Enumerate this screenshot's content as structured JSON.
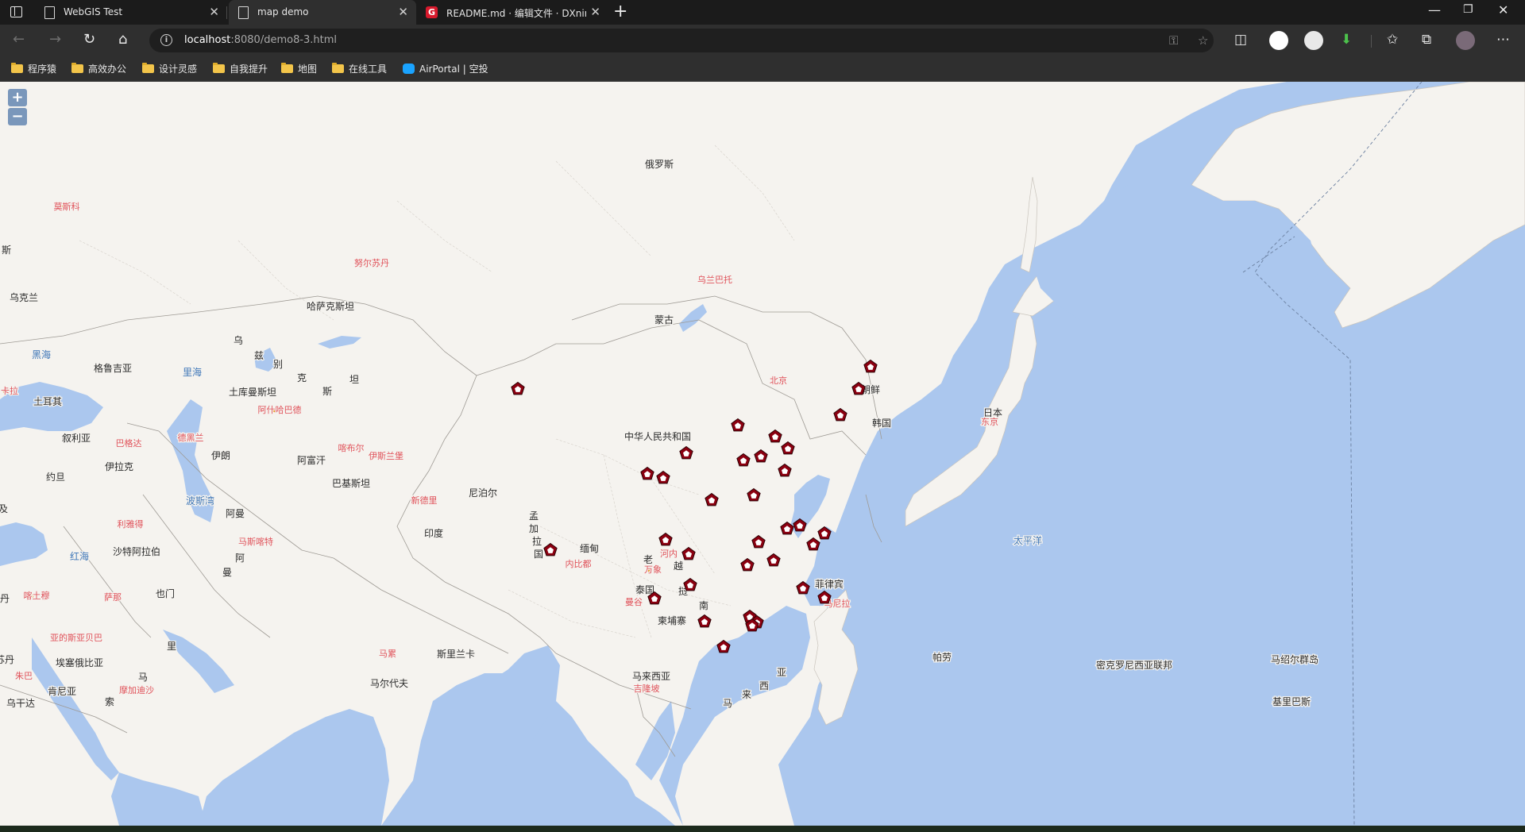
{
  "browser": {
    "tabs": [
      {
        "title": "WebGIS Test",
        "active": false
      },
      {
        "title": "map demo",
        "active": true
      },
      {
        "title": "README.md · 编辑文件 · DXnim",
        "active": false
      }
    ],
    "address": {
      "host": "localhost",
      "rest": ":8080/demo8-3.html"
    },
    "bookmarks": [
      "程序猿",
      "高效办公",
      "设计灵感",
      "自我提升",
      "地图",
      "在线工具",
      "AirPortal | 空投"
    ]
  },
  "map": {
    "zoom_in": "+",
    "zoom_out": "−",
    "ocean_color": "#abc7ee",
    "land_color": "#f5f3ef",
    "marker_color": "#8b0010",
    "labels": [
      {
        "id": "ru",
        "text": "俄罗斯",
        "kind": "country"
      },
      {
        "id": "moscow",
        "text": "莫斯科",
        "kind": "capital"
      },
      {
        "id": "nursultan",
        "text": "努尔苏丹",
        "kind": "capital"
      },
      {
        "id": "kz",
        "text": "哈萨克斯坦",
        "kind": "country"
      },
      {
        "id": "ua",
        "text": "乌克兰",
        "kind": "country"
      },
      {
        "id": "si",
        "text": "斯",
        "kind": "country"
      },
      {
        "id": "blacksea",
        "text": "黑海",
        "kind": "water"
      },
      {
        "id": "caspian",
        "text": "里海",
        "kind": "water"
      },
      {
        "id": "ge",
        "text": "格鲁吉亚",
        "kind": "country"
      },
      {
        "id": "tr",
        "text": "土耳其",
        "kind": "country"
      },
      {
        "id": "ankara",
        "text": "卡拉",
        "kind": "capital"
      },
      {
        "id": "uz1",
        "text": "乌",
        "kind": "country"
      },
      {
        "id": "uz2",
        "text": "兹",
        "kind": "country"
      },
      {
        "id": "uz3",
        "text": "别",
        "kind": "country"
      },
      {
        "id": "uz4",
        "text": "克",
        "kind": "country"
      },
      {
        "id": "uz5",
        "text": "斯",
        "kind": "country"
      },
      {
        "id": "uz6",
        "text": "坦",
        "kind": "country"
      },
      {
        "id": "tm",
        "text": "土库曼斯坦",
        "kind": "country"
      },
      {
        "id": "ashgabat",
        "text": "阿什哈巴德",
        "kind": "capital"
      },
      {
        "id": "sy",
        "text": "叙利亚",
        "kind": "country"
      },
      {
        "id": "baghdad",
        "text": "巴格达",
        "kind": "capital"
      },
      {
        "id": "tehran",
        "text": "德黑兰",
        "kind": "capital"
      },
      {
        "id": "iq",
        "text": "伊拉克",
        "kind": "country"
      },
      {
        "id": "ir",
        "text": "伊朗",
        "kind": "country"
      },
      {
        "id": "kabul",
        "text": "喀布尔",
        "kind": "capital"
      },
      {
        "id": "islamabad",
        "text": "伊斯兰堡",
        "kind": "capital"
      },
      {
        "id": "af",
        "text": "阿富汗",
        "kind": "country"
      },
      {
        "id": "pk",
        "text": "巴基斯坦",
        "kind": "country"
      },
      {
        "id": "jo",
        "text": "约旦",
        "kind": "country"
      },
      {
        "id": "eg",
        "text": "及",
        "kind": "country"
      },
      {
        "id": "gulf",
        "text": "波斯湾",
        "kind": "water"
      },
      {
        "id": "om1",
        "text": "阿曼",
        "kind": "country"
      },
      {
        "id": "riyadh",
        "text": "利雅得",
        "kind": "capital"
      },
      {
        "id": "muscat",
        "text": "马斯喀特",
        "kind": "capital"
      },
      {
        "id": "sa",
        "text": "沙特阿拉伯",
        "kind": "country"
      },
      {
        "id": "om2",
        "text": "阿",
        "kind": "country"
      },
      {
        "id": "om3",
        "text": "曼",
        "kind": "country"
      },
      {
        "id": "redsea",
        "text": "红海",
        "kind": "water"
      },
      {
        "id": "sanaa",
        "text": "萨那",
        "kind": "capital"
      },
      {
        "id": "ye",
        "text": "也门",
        "kind": "country"
      },
      {
        "id": "khartoum",
        "text": "喀土穆",
        "kind": "capital"
      },
      {
        "id": "sd",
        "text": "丹",
        "kind": "country"
      },
      {
        "id": "addis",
        "text": "亚的斯亚贝巴",
        "kind": "capital"
      },
      {
        "id": "et",
        "text": "埃塞俄比亚",
        "kind": "country"
      },
      {
        "id": "so1",
        "text": "里",
        "kind": "country"
      },
      {
        "id": "so2",
        "text": "马",
        "kind": "country"
      },
      {
        "id": "ss",
        "text": "苏丹",
        "kind": "country"
      },
      {
        "id": "juba",
        "text": "朱巴",
        "kind": "capital"
      },
      {
        "id": "mogadishu",
        "text": "摩加迪沙",
        "kind": "capital"
      },
      {
        "id": "ke",
        "text": "肯尼亚",
        "kind": "country"
      },
      {
        "id": "so3",
        "text": "索",
        "kind": "country"
      },
      {
        "id": "ug",
        "text": "乌干达",
        "kind": "country"
      },
      {
        "id": "newdelhi",
        "text": "新德里",
        "kind": "capital"
      },
      {
        "id": "np",
        "text": "尼泊尔",
        "kind": "country"
      },
      {
        "id": "in",
        "text": "印度",
        "kind": "country"
      },
      {
        "id": "bd1",
        "text": "孟",
        "kind": "country"
      },
      {
        "id": "bd2",
        "text": "加",
        "kind": "country"
      },
      {
        "id": "bd3",
        "text": "拉",
        "kind": "country"
      },
      {
        "id": "bd4",
        "text": "国",
        "kind": "country"
      },
      {
        "id": "mm",
        "text": "缅甸",
        "kind": "country"
      },
      {
        "id": "naypyidaw",
        "text": "内比都",
        "kind": "capital"
      },
      {
        "id": "male",
        "text": "马累",
        "kind": "capital"
      },
      {
        "id": "lk",
        "text": "斯里兰卡",
        "kind": "country"
      },
      {
        "id": "mv",
        "text": "马尔代夫",
        "kind": "country"
      },
      {
        "id": "ulaanbaatar",
        "text": "乌兰巴托",
        "kind": "capital"
      },
      {
        "id": "mn",
        "text": "蒙古",
        "kind": "country"
      },
      {
        "id": "cn",
        "text": "中华人民共和国",
        "kind": "country"
      },
      {
        "id": "beijing",
        "text": "北京",
        "kind": "capital"
      },
      {
        "id": "kp",
        "text": "朝鲜",
        "kind": "country"
      },
      {
        "id": "kr",
        "text": "韩国",
        "kind": "country"
      },
      {
        "id": "jp",
        "text": "日本",
        "kind": "country"
      },
      {
        "id": "tokyo",
        "text": "东京",
        "kind": "capital"
      },
      {
        "id": "hanoi",
        "text": "河内",
        "kind": "capital"
      },
      {
        "id": "la",
        "text": "老",
        "kind": "country"
      },
      {
        "id": "vn1",
        "text": "越",
        "kind": "country"
      },
      {
        "id": "vientiane",
        "text": "万象",
        "kind": "capital"
      },
      {
        "id": "th",
        "text": "泰国",
        "kind": "country"
      },
      {
        "id": "vn2",
        "text": "挝",
        "kind": "country"
      },
      {
        "id": "bangkok",
        "text": "曼谷",
        "kind": "capital"
      },
      {
        "id": "vn3",
        "text": "南",
        "kind": "country"
      },
      {
        "id": "kh",
        "text": "柬埔寨",
        "kind": "country"
      },
      {
        "id": "ph",
        "text": "菲律宾",
        "kind": "country"
      },
      {
        "id": "manila",
        "text": "马尼拉",
        "kind": "capital"
      },
      {
        "id": "pacific",
        "text": "太平洋",
        "kind": "water"
      },
      {
        "id": "pw",
        "text": "帕劳",
        "kind": "country"
      },
      {
        "id": "fm",
        "text": "密克罗尼西亚联邦",
        "kind": "country"
      },
      {
        "id": "mh",
        "text": "马绍尔群岛",
        "kind": "country"
      },
      {
        "id": "ki",
        "text": "基里巴斯",
        "kind": "country"
      },
      {
        "id": "my",
        "text": "马来西亚",
        "kind": "country"
      },
      {
        "id": "kl",
        "text": "吉隆坡",
        "kind": "capital"
      },
      {
        "id": "id1",
        "text": "亚",
        "kind": "country"
      },
      {
        "id": "id2",
        "text": "西",
        "kind": "country"
      },
      {
        "id": "id3",
        "text": "来",
        "kind": "country"
      },
      {
        "id": "id4",
        "text": "马",
        "kind": "country"
      }
    ]
  }
}
